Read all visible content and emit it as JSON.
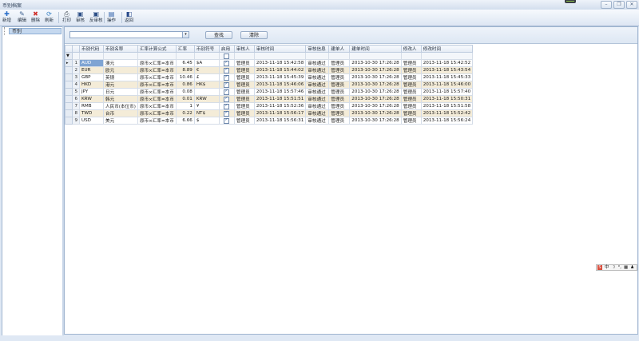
{
  "window": {
    "title": "币别档案"
  },
  "toolbar": [
    {
      "label": "新增",
      "icon": "plus-icon",
      "glyph": "✚",
      "color": "#2a6fc9"
    },
    {
      "label": "编辑",
      "icon": "edit-icon",
      "glyph": "✎",
      "color": "#3b5f8f"
    },
    {
      "label": "删除",
      "icon": "delete-icon",
      "glyph": "✖",
      "color": "#d0302a"
    },
    {
      "label": "刷新",
      "icon": "refresh-icon",
      "glyph": "⟳",
      "color": "#2f7bc0"
    },
    {
      "label": "打印",
      "icon": "print-icon",
      "glyph": "⎙",
      "color": "#555d66"
    },
    {
      "label": "审核",
      "icon": "approve-icon",
      "glyph": "▣",
      "color": "#2d4f86"
    },
    {
      "label": "反审核",
      "icon": "unapprove-icon",
      "glyph": "▣",
      "color": "#2d4f86"
    },
    {
      "label": "操作",
      "icon": "operate-icon",
      "glyph": "▤",
      "color": "#2d5ea8"
    },
    {
      "label": "返回",
      "icon": "return-icon",
      "glyph": "◧",
      "color": "#27498a"
    }
  ],
  "tree": {
    "root": "币别"
  },
  "search": {
    "query_value": "",
    "find_label": "查找",
    "clear_label": "清除"
  },
  "grid": {
    "columns": [
      "币别代码",
      "币别名称",
      "汇率计算公式",
      "汇率",
      "币别符号",
      "启用",
      "审核人",
      "审核时间",
      "审核信息",
      "建单人",
      "建单时间",
      "修改人",
      "修改时间"
    ],
    "rows": [
      {
        "no": "1",
        "code": "AUD",
        "name": "澳元",
        "formula": "原币×汇率=本币",
        "rate": "6.45",
        "symbol": "$A",
        "enabled": true,
        "auditor": "管理员",
        "audit_time": "2013-11-18 15:42:58",
        "audit_info": "审核通过",
        "creator": "管理员",
        "create_time": "2013-10-30 17:26:28",
        "modifier": "管理员",
        "modify_time": "2013-11-18 15:42:52"
      },
      {
        "no": "2",
        "code": "EUR",
        "name": "欧元",
        "formula": "原币×汇率=本币",
        "rate": "8.89",
        "symbol": "€",
        "enabled": true,
        "auditor": "管理员",
        "audit_time": "2013-11-18 15:44:02",
        "audit_info": "审核通过",
        "creator": "管理员",
        "create_time": "2013-10-30 17:26:28",
        "modifier": "管理员",
        "modify_time": "2013-11-18 15:43:54"
      },
      {
        "no": "3",
        "code": "GBP",
        "name": "英镑",
        "formula": "原币×汇率=本币",
        "rate": "10.46",
        "symbol": "£",
        "enabled": true,
        "auditor": "管理员",
        "audit_time": "2013-11-18 15:45:39",
        "audit_info": "审核通过",
        "creator": "管理员",
        "create_time": "2013-10-30 17:26:28",
        "modifier": "管理员",
        "modify_time": "2013-11-18 15:45:33"
      },
      {
        "no": "4",
        "code": "HKD",
        "name": "港元",
        "formula": "原币×汇率=本币",
        "rate": "0.86",
        "symbol": "HK$",
        "enabled": true,
        "auditor": "管理员",
        "audit_time": "2013-11-18 15:46:06",
        "audit_info": "审核通过",
        "creator": "管理员",
        "create_time": "2013-10-30 17:26:28",
        "modifier": "管理员",
        "modify_time": "2013-11-18 15:46:00"
      },
      {
        "no": "5",
        "code": "JPY",
        "name": "日元",
        "formula": "原币×汇率=本币",
        "rate": "0.08",
        "symbol": "",
        "enabled": true,
        "auditor": "管理员",
        "audit_time": "2013-11-18 15:57:46",
        "audit_info": "审核通过",
        "creator": "管理员",
        "create_time": "2013-10-30 17:26:28",
        "modifier": "管理员",
        "modify_time": "2013-11-18 15:57:40"
      },
      {
        "no": "6",
        "code": "KRW",
        "name": "韩元",
        "formula": "原币×汇率=本币",
        "rate": "0.01",
        "symbol": "KRW",
        "enabled": true,
        "auditor": "管理员",
        "audit_time": "2013-11-18 15:51:51",
        "audit_info": "审核通过",
        "creator": "管理员",
        "create_time": "2013-10-30 17:26:28",
        "modifier": "管理员",
        "modify_time": "2013-11-18 15:50:31"
      },
      {
        "no": "7",
        "code": "RMB",
        "name": "人民币(本位币)",
        "formula": "原币×汇率=本币",
        "rate": "1",
        "symbol": "¥",
        "enabled": true,
        "auditor": "管理员",
        "audit_time": "2013-11-18 15:52:36",
        "audit_info": "审核通过",
        "creator": "管理员",
        "create_time": "2013-10-30 17:26:28",
        "modifier": "管理员",
        "modify_time": "2013-11-18 15:51:58"
      },
      {
        "no": "8",
        "code": "TWD",
        "name": "台币",
        "formula": "原币×汇率=本币",
        "rate": "0.22",
        "symbol": "NT$",
        "enabled": true,
        "auditor": "管理员",
        "audit_time": "2013-11-18 15:56:17",
        "audit_info": "审核通过",
        "creator": "管理员",
        "create_time": "2013-10-30 17:26:28",
        "modifier": "管理员",
        "modify_time": "2013-11-18 15:52:42"
      },
      {
        "no": "9",
        "code": "USD",
        "name": "美元",
        "formula": "原币×汇率=本币",
        "rate": "6.66",
        "symbol": "$",
        "enabled": true,
        "auditor": "管理员",
        "audit_time": "2013-11-18 15:56:31",
        "audit_info": "审核通过",
        "creator": "管理员",
        "create_time": "2013-10-30 17:26:28",
        "modifier": "管理员",
        "modify_time": "2013-11-18 15:56:24"
      }
    ]
  },
  "ime": {
    "lang": "中",
    "icons": [
      "moon-icon",
      "punct-icon",
      "keyboard-icon",
      "user-icon"
    ]
  },
  "colors": {
    "selected_code_bg": "#7fa4d3",
    "even_row_bg": "#f4ecd8",
    "chrome": "#dfe8f4"
  }
}
